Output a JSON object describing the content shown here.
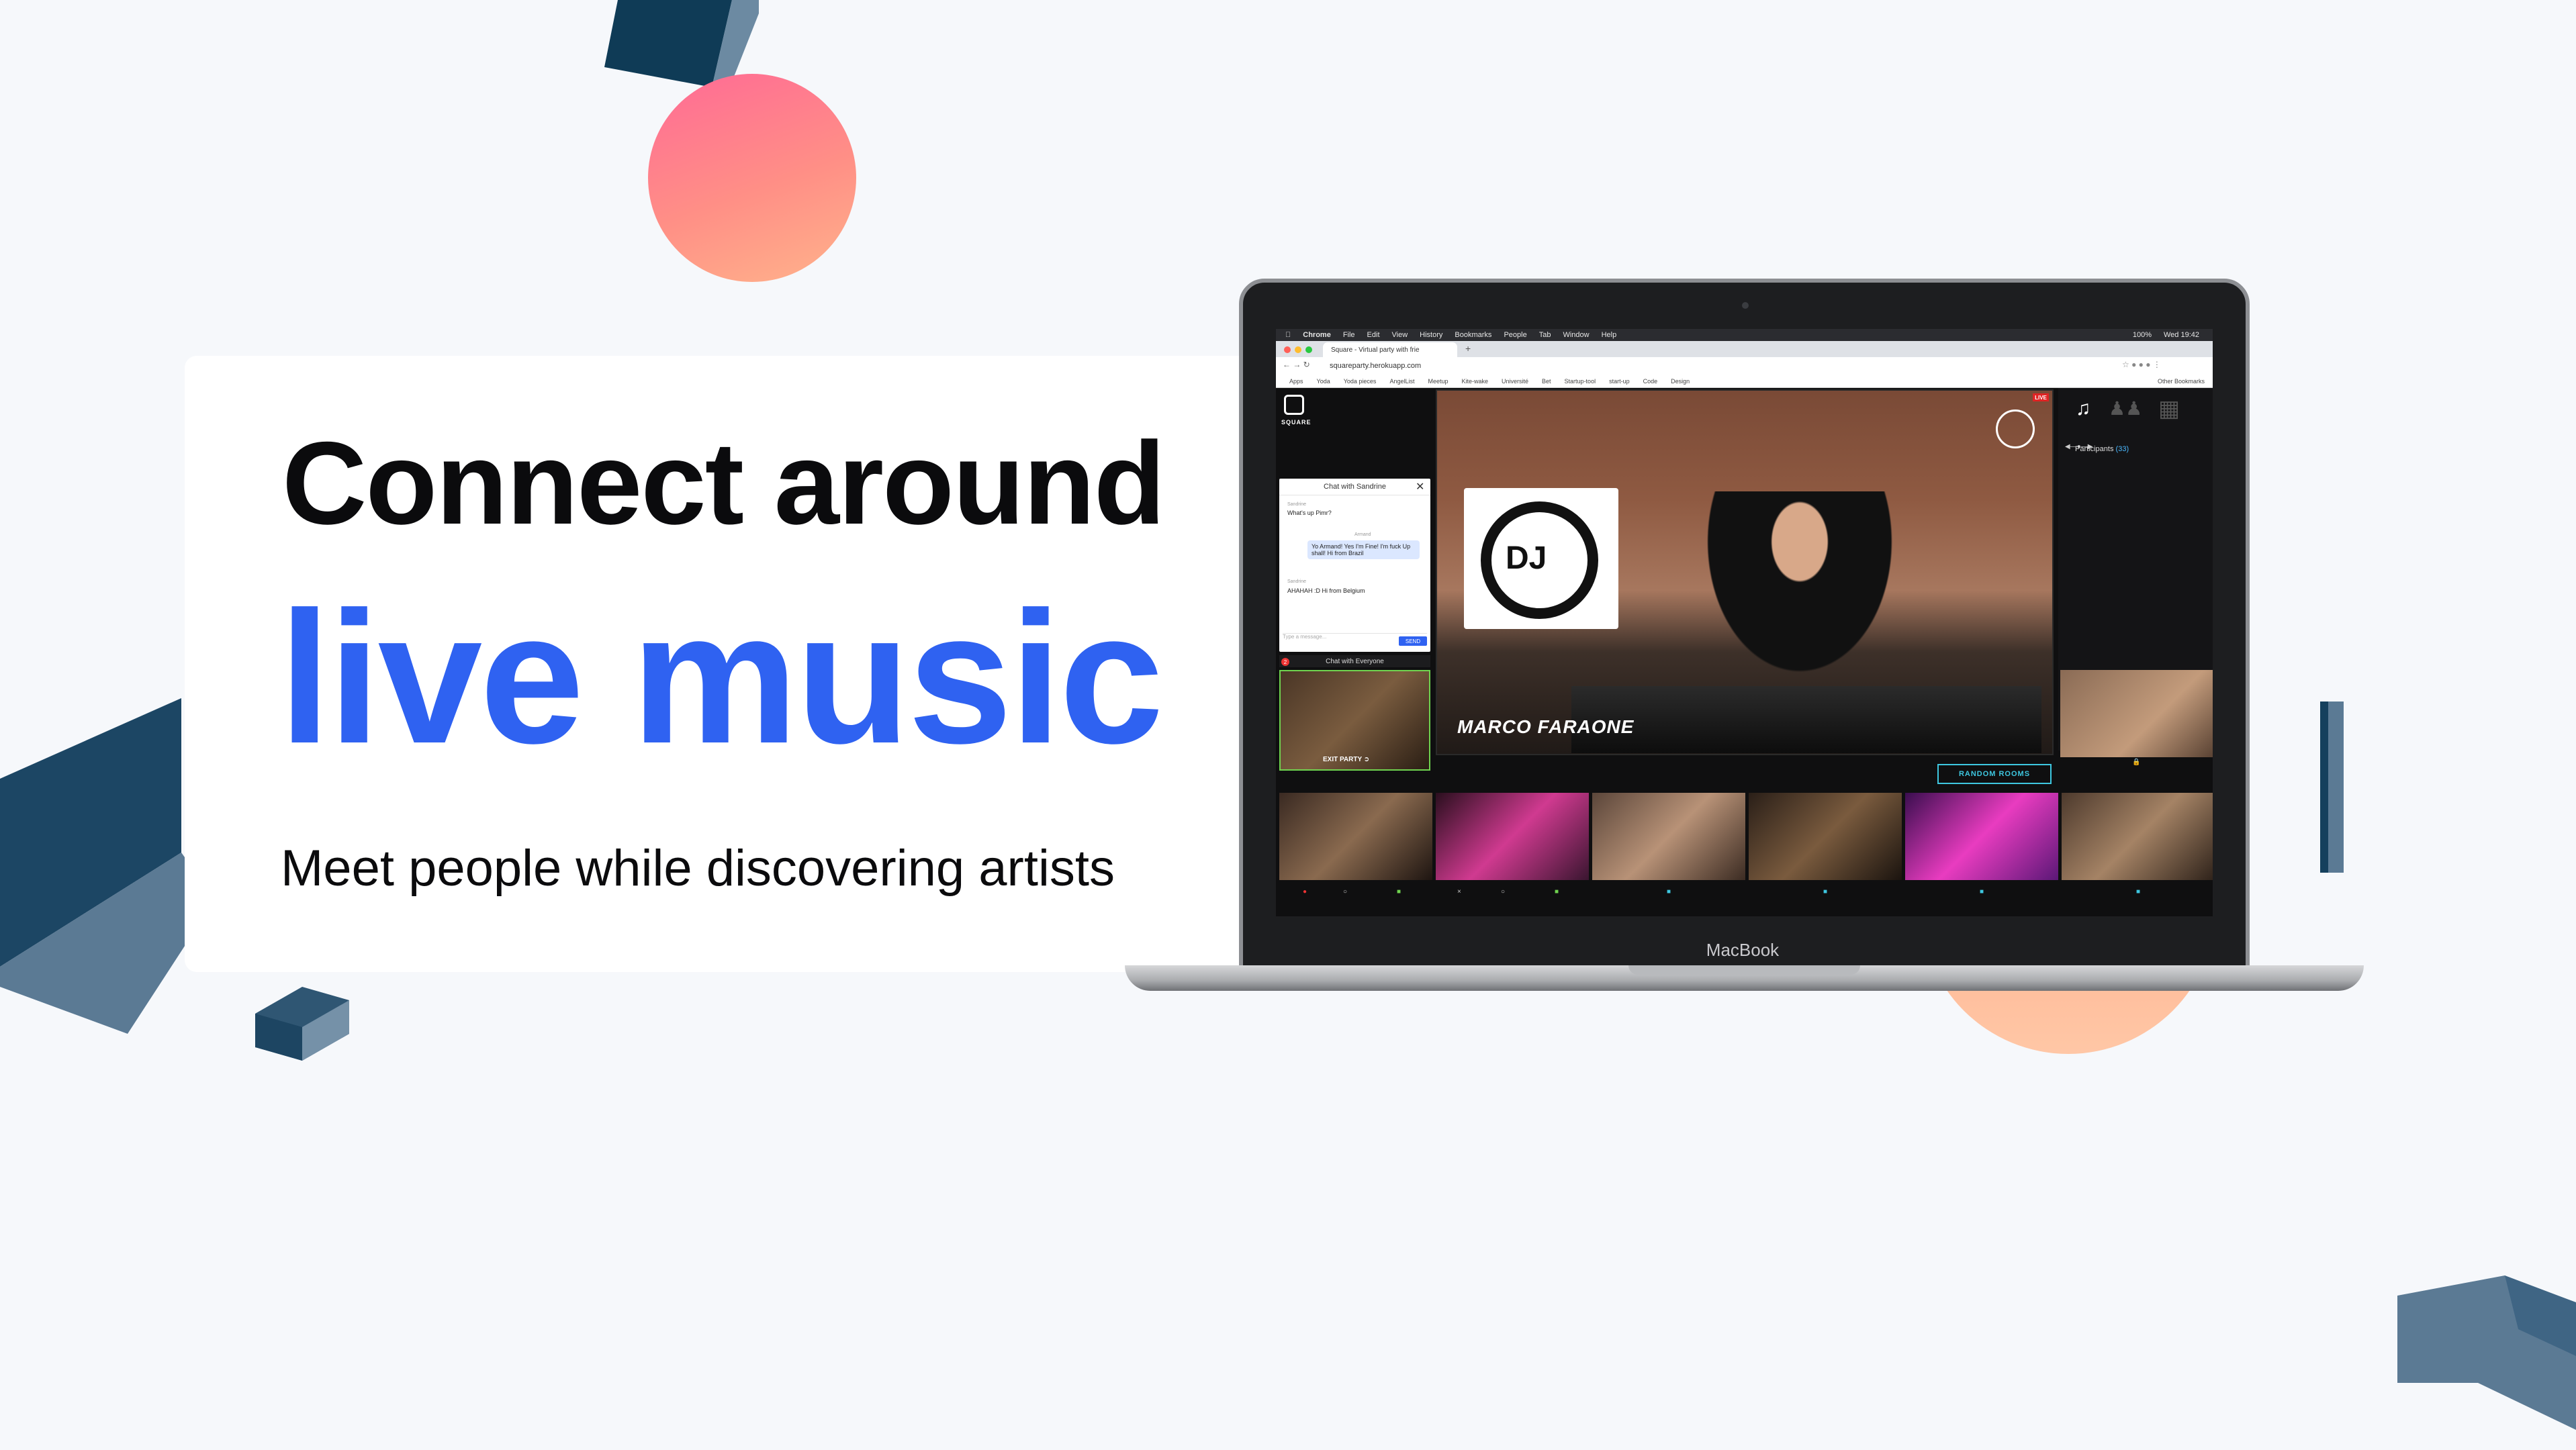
{
  "hero": {
    "line1": "Connect around",
    "line2": "live music",
    "subtitle": "Meet people while discovering artists"
  },
  "colors": {
    "accent": "#2f62f1",
    "live": "#e02424",
    "random_rooms": "#3ec7e0"
  },
  "laptop": {
    "label": "MacBook"
  },
  "macos": {
    "menu": [
      "Chrome",
      "File",
      "Edit",
      "View",
      "History",
      "Bookmarks",
      "People",
      "Tab",
      "Window",
      "Help"
    ],
    "clock": "Wed 19:42",
    "battery": "100%"
  },
  "browser": {
    "tab_title": "Square - Virtual party with frie",
    "url": "squareparty.herokuapp.com",
    "bookmarks": [
      "Apps",
      "Yoda",
      "Yoda pieces",
      "AngelList",
      "Meetup",
      "Kite-wake",
      "Université",
      "Bet",
      "Startup-tool",
      "start-up",
      "Code",
      "Design",
      "Other Bookmarks"
    ]
  },
  "app": {
    "logo_text": "SQUARE",
    "chat": {
      "title": "Chat with Sandrine",
      "messages": [
        {
          "from": "Sandrine",
          "text": "What's up Pimr?"
        },
        {
          "from": "Armand",
          "text": "Yo Armand! Yes I'm Fine! I'm fuck Up shall! Hi from Brazil"
        },
        {
          "from": "Sandrine",
          "text": "AHAHAH :D Hi from Belgium"
        }
      ],
      "input_placeholder": "Type a message...",
      "send_label": "SEND"
    },
    "chat_everyone": {
      "label": "Chat with Everyone",
      "badge": "2"
    },
    "exit_label": "EXIT PARTY",
    "main_stage": {
      "artist": "MARCO FARAONE",
      "live_label": "LIVE",
      "dj_logo_text": "DJ"
    },
    "participants_label": "Participants",
    "participants_count": "(33)",
    "random_rooms_label": "RANDOM ROOMS"
  }
}
